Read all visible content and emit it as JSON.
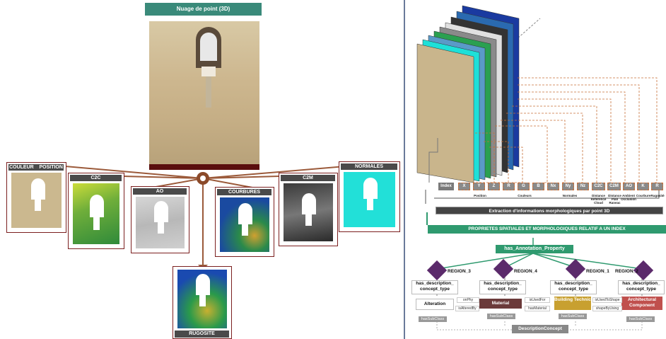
{
  "left": {
    "main_title": "Nuage de point (3D)",
    "panels": {
      "couleur": "COULEUR",
      "position": "POSITION",
      "c2c": "C2C",
      "ao": "AO",
      "courbures": "COURBURES",
      "c2m": "C2M",
      "normales": "NORMALES",
      "rugosite": "RUGOSITE"
    }
  },
  "right": {
    "index_boxes": [
      "Index",
      "X",
      "Y",
      "Z",
      "R",
      "G",
      "B",
      "Nx",
      "Ny",
      "Nz",
      "C2C",
      "C2M",
      "AO",
      "K",
      "R"
    ],
    "sub_labels": {
      "position": "Position",
      "couleurs": "Couleurs",
      "normales": "Normales",
      "distance_cloud": "Distance Reference Cloud",
      "distance_plan": "Distance Plan Raneac",
      "ambient": "Ambient Occlusion",
      "courbure": "Courbure",
      "rugosite": "Rugosité"
    },
    "extraction_bar": "Extraction d'informations morphologiques par point 3D",
    "properties_bar": "PROPRIETES SPATIALES ET MORPHOLOGIQUES RELATIF A UN INDEX",
    "annotation_property": "has_Annotation_Property",
    "regions": [
      "REGION_3",
      "REGION_4",
      "REGION_1",
      "REGION_2"
    ],
    "concept_type_line1": "has_description_",
    "concept_type_line2": "concept_type",
    "concepts": [
      "Alteration",
      "Material",
      "Building Technic",
      "Architectural Component"
    ],
    "has_subclass": "hasSubClass",
    "description_concept": "DescriptionConcept",
    "edges": {
      "e1": "onPhy",
      "e2": "isAlteredBy",
      "e3": "isUsedFor",
      "e4": "hasMaterial",
      "e5": "isUsedToShape",
      "e6": "shapeByUsing"
    },
    "colors": {
      "teal": "#2f9a6f",
      "diamond": "#5b2a6b",
      "material": "#6b3a3a",
      "building": "#c8a030",
      "architectural": "#c0504d"
    }
  }
}
